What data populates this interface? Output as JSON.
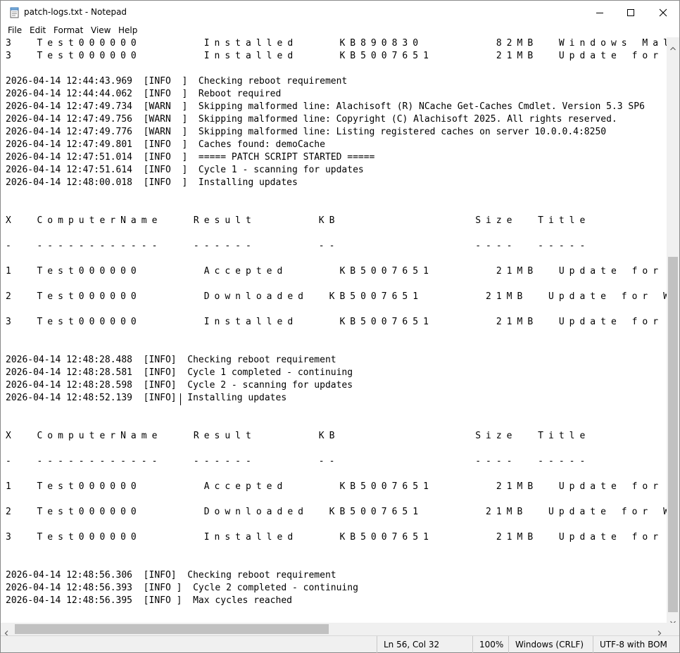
{
  "window": {
    "title": "patch-logs.txt - Notepad"
  },
  "menu": {
    "file": "File",
    "edit": "Edit",
    "format": "Format",
    "view": "View",
    "help": "Help"
  },
  "editor": {
    "lines": [
      "3  Test000000      Installed    KB890830       82MB  Windows Malicio",
      "3  Test000000      Installed    KB5007651      21MB  Update for Wind",
      "",
      "2026-04-14 12:44:43.969  [INFO  ]  Checking reboot requirement",
      "2026-04-14 12:44:44.062  [INFO  ]  Reboot required",
      "2026-04-14 12:47:49.734  [WARN  ]  Skipping malformed line: Alachisoft (R) NCache Get-Caches Cmdlet. Version 5.3 SP6",
      "2026-04-14 12:47:49.756  [WARN  ]  Skipping malformed line: Copyright (C) Alachisoft 2025. All rights reserved.",
      "2026-04-14 12:47:49.776  [WARN  ]  Skipping malformed line: Listing registered caches on server 10.0.0.4:8250",
      "2026-04-14 12:47:49.801  [INFO  ]  Caches found: demoCache",
      "2026-04-14 12:47:51.014  [INFO  ]  ===== PATCH SCRIPT STARTED =====",
      "2026-04-14 12:47:51.614  [INFO  ]  Cycle 1 - scanning for updates",
      "2026-04-14 12:48:00.018  [INFO  ]  Installing updates",
      "",
      "",
      "X  ComputerName   Result      KB             Size  Title",
      "",
      "-  ------------   ------      --             ----  -----",
      "",
      "1  Test000000      Accepted     KB5007651      21MB  Update for Wind",
      "",
      "2  Test000000      Downloaded  KB5007651      21MB  Update for Wind",
      "",
      "3  Test000000      Installed    KB5007651      21MB  Update for Wind",
      "",
      "",
      "2026-04-14 12:48:28.488  [INFO]  Checking reboot requirement",
      "2026-04-14 12:48:28.581  [INFO]  Cycle 1 completed - continuing",
      "2026-04-14 12:48:28.598  [INFO]  Cycle 2 - scanning for updates",
      "2026-04-14 12:48:52.139  [INFO]  Installing updates",
      "",
      "",
      "X  ComputerName   Result      KB             Size  Title",
      "",
      "-  ------------   ------      --             ----  -----",
      "",
      "1  Test000000      Accepted     KB5007651      21MB  Update for Wind",
      "",
      "2  Test000000      Downloaded  KB5007651      21MB  Update for Wind",
      "",
      "3  Test000000      Installed    KB5007651      21MB  Update for Wind",
      "",
      "",
      "2026-04-14 12:48:56.306  [INFO]  Checking reboot requirement",
      "2026-04-14 12:48:56.393  [INFO ]  Cycle 2 completed - continuing",
      "2026-04-14 12:48:56.395  [INFO ]  Max cycles reached"
    ]
  },
  "status": {
    "position": "Ln 56, Col 32",
    "zoom": "100%",
    "line_ending": "Windows (CRLF)",
    "encoding": "UTF-8 with BOM"
  }
}
